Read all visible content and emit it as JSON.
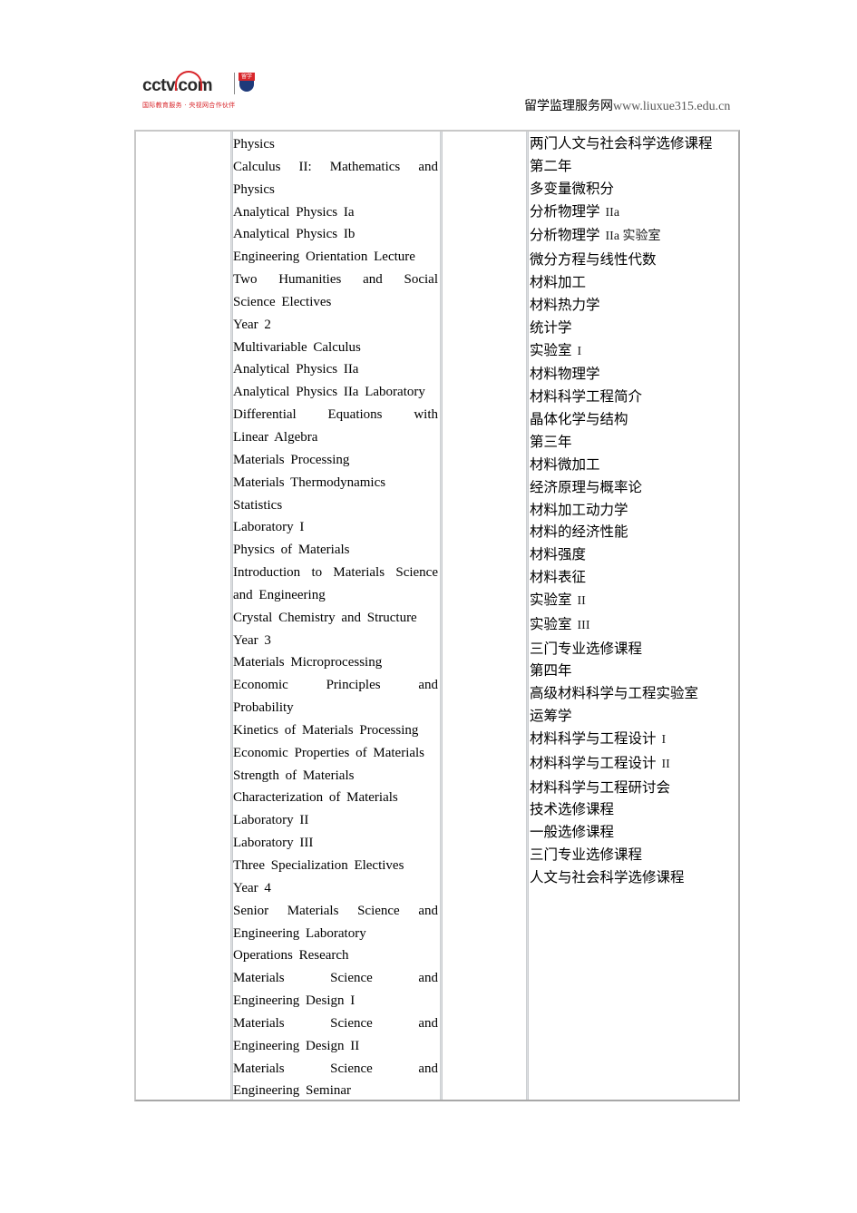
{
  "header": {
    "logo": {
      "brand": "cctv.com",
      "badge": "留学",
      "subtitle": "国际教育服务 · 央视网合作伙伴"
    },
    "site_name": "留学监理服务网",
    "site_url": "www.liuxue315.edu.cn"
  },
  "table": {
    "col1": "",
    "english_courses": [
      {
        "text": "Physics"
      },
      {
        "text": "Calculus II: Mathematics and",
        "justify": true
      },
      {
        "text": "Physics"
      },
      {
        "text": "Analytical Physics Ia"
      },
      {
        "text": "Analytical Physics Ib"
      },
      {
        "text": "Engineering Orientation Lecture"
      },
      {
        "text": "Two Humanities and Social",
        "justify": true
      },
      {
        "text": "Science Electives"
      },
      {
        "text": "Year 2"
      },
      {
        "text": "Multivariable Calculus"
      },
      {
        "text": "Analytical Physics IIa"
      },
      {
        "text": "Analytical Physics IIa Laboratory"
      },
      {
        "text": "Differential Equations with",
        "justify": true
      },
      {
        "text": "Linear Algebra"
      },
      {
        "text": "Materials Processing"
      },
      {
        "text": "Materials Thermodynamics"
      },
      {
        "text": "Statistics"
      },
      {
        "text": "Laboratory I"
      },
      {
        "text": "Physics of Materials"
      },
      {
        "text": "Introduction to Materials Science",
        "justify": true
      },
      {
        "text": "and Engineering"
      },
      {
        "text": "Crystal Chemistry and Structure"
      },
      {
        "text": "Year 3"
      },
      {
        "text": "Materials Microprocessing"
      },
      {
        "text": "Economic Principles and",
        "justify": true
      },
      {
        "text": "Probability"
      },
      {
        "text": "Kinetics of Materials Processing"
      },
      {
        "text": "Economic Properties of Materials"
      },
      {
        "text": "Strength of Materials"
      },
      {
        "text": "Characterization of Materials"
      },
      {
        "text": "Laboratory II"
      },
      {
        "text": "Laboratory III"
      },
      {
        "text": "Three Specialization Electives"
      },
      {
        "text": "Year 4"
      },
      {
        "text": "Senior Materials Science and",
        "justify": true
      },
      {
        "text": "Engineering Laboratory"
      },
      {
        "text": "Operations Research"
      },
      {
        "text": "Materials Science and",
        "justify": true
      },
      {
        "text": "Engineering Design I"
      },
      {
        "text": "Materials Science and",
        "justify": true
      },
      {
        "text": "Engineering Design II"
      },
      {
        "text": "Materials Science and",
        "justify": true
      },
      {
        "text": "Engineering Seminar"
      }
    ],
    "col3": "",
    "chinese_courses": [
      {
        "zh": "两门人文与社会科学选修课程",
        "roman": ""
      },
      {
        "zh": "第二年",
        "roman": ""
      },
      {
        "zh": "多变量微积分",
        "roman": ""
      },
      {
        "zh": "分析物理学",
        "roman": "IIa"
      },
      {
        "zh": "分析物理学",
        "roman": "IIa 实验室"
      },
      {
        "zh": "微分方程与线性代数",
        "roman": ""
      },
      {
        "zh": "材料加工",
        "roman": ""
      },
      {
        "zh": "材料热力学",
        "roman": ""
      },
      {
        "zh": "统计学",
        "roman": ""
      },
      {
        "zh": "实验室",
        "roman": "I"
      },
      {
        "zh": "材料物理学",
        "roman": ""
      },
      {
        "zh": "材料科学工程简介",
        "roman": ""
      },
      {
        "zh": "晶体化学与结构",
        "roman": ""
      },
      {
        "zh": "第三年",
        "roman": ""
      },
      {
        "zh": "材料微加工",
        "roman": ""
      },
      {
        "zh": "经济原理与概率论",
        "roman": ""
      },
      {
        "zh": "材料加工动力学",
        "roman": ""
      },
      {
        "zh": "材料的经济性能",
        "roman": ""
      },
      {
        "zh": "材料强度",
        "roman": ""
      },
      {
        "zh": "材料表征",
        "roman": ""
      },
      {
        "zh": "实验室",
        "roman": "II"
      },
      {
        "zh": "实验室",
        "roman": "III"
      },
      {
        "zh": "三门专业选修课程",
        "roman": ""
      },
      {
        "zh": "第四年",
        "roman": ""
      },
      {
        "zh": "高级材料科学与工程实验室",
        "roman": ""
      },
      {
        "zh": "运筹学",
        "roman": ""
      },
      {
        "zh": "材料科学与工程设计",
        "roman": "I"
      },
      {
        "zh": "材料科学与工程设计",
        "roman": "II"
      },
      {
        "zh": "材料科学与工程研讨会",
        "roman": ""
      },
      {
        "zh": "技术选修课程",
        "roman": ""
      },
      {
        "zh": "一般选修课程",
        "roman": ""
      },
      {
        "zh": "三门专业选修课程",
        "roman": ""
      },
      {
        "zh": "人文与社会科学选修课程",
        "roman": ""
      }
    ]
  }
}
